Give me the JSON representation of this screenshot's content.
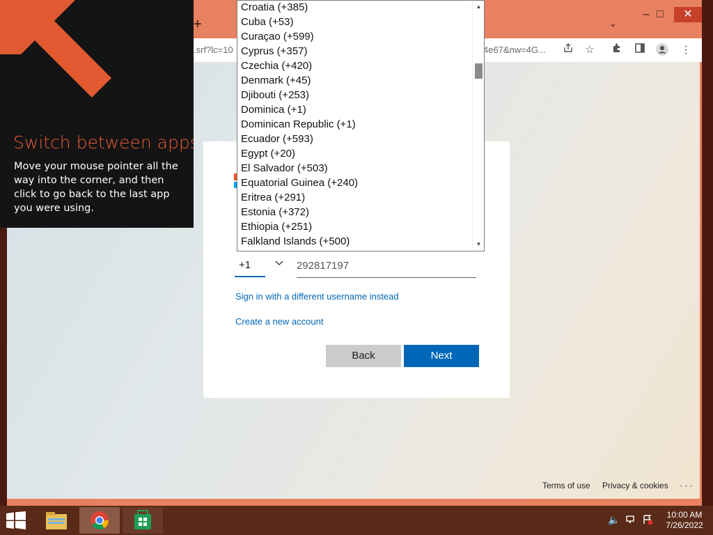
{
  "browser": {
    "url_fragment": ".srf?lc=10",
    "url_tail": "4e67&nw=4G...",
    "controls": {
      "minimize": "–",
      "maximize": "□",
      "close": "✕"
    }
  },
  "form": {
    "country_code": "+1",
    "phone_number": "292817197",
    "link_different_username": "Sign in with a different username instead",
    "link_create_account": "Create a new account",
    "back_label": "Back",
    "next_label": "Next"
  },
  "footer": {
    "terms": "Terms of use",
    "privacy": "Privacy & cookies",
    "more": "· · ·"
  },
  "country_dropdown": {
    "items": [
      "Croatia (+385)",
      "Cuba (+53)",
      "Curaçao (+599)",
      "Cyprus (+357)",
      "Czechia (+420)",
      "Denmark (+45)",
      "Djibouti (+253)",
      "Dominica (+1)",
      "Dominican Republic (+1)",
      "Ecuador (+593)",
      "Egypt (+20)",
      "El Salvador (+503)",
      "Equatorial Guinea (+240)",
      "Eritrea (+291)",
      "Estonia (+372)",
      "Ethiopia (+251)",
      "Falkland Islands (+500)"
    ]
  },
  "tip": {
    "title": "Switch between apps",
    "body": "Move your mouse pointer all the way into the corner, and then click to go back to the last app you were using."
  },
  "taskbar": {
    "time": "10:00 AM",
    "date": "7/26/2022"
  },
  "colors": {
    "accent": "#0067b8",
    "tip_title": "#e85a38",
    "browser_frame": "#e8815f",
    "taskbar": "#5a2a18"
  }
}
